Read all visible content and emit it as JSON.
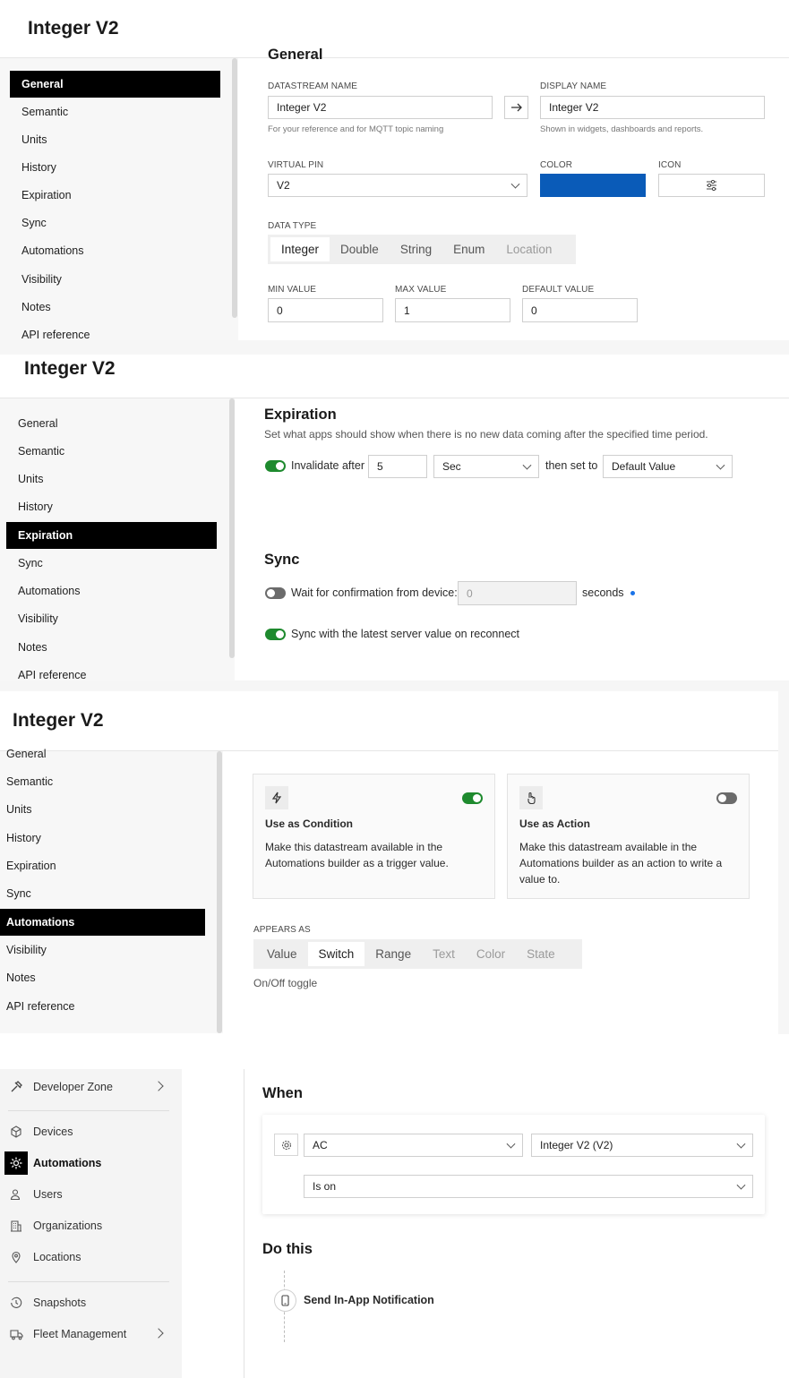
{
  "title": "Integer V2",
  "nav_items": [
    "General",
    "Semantic",
    "Units",
    "History",
    "Expiration",
    "Sync",
    "Automations",
    "Visibility",
    "Notes",
    "API reference"
  ],
  "general": {
    "heading": "General",
    "datastream_name_label": "DATASTREAM NAME",
    "datastream_name_value": "Integer V2",
    "datastream_name_help": "For your reference and for MQTT topic naming",
    "display_name_label": "DISPLAY NAME",
    "display_name_value": "Integer V2",
    "display_name_help": "Shown in widgets, dashboards and reports.",
    "virtual_pin_label": "VIRTUAL PIN",
    "virtual_pin_value": "V2",
    "color_label": "COLOR",
    "color_value": "#0a5bb8",
    "icon_label": "ICON",
    "icon_name": "sliders-icon",
    "data_type_label": "DATA TYPE",
    "data_types": [
      "Integer",
      "Double",
      "String",
      "Enum",
      "Location"
    ],
    "data_type_selected": "Integer",
    "min_label": "MIN VALUE",
    "min_value": "0",
    "max_label": "MAX VALUE",
    "max_value": "1",
    "default_label": "DEFAULT VALUE",
    "default_value": "0"
  },
  "expiration": {
    "heading": "Expiration",
    "description": "Set what apps should show when there is no new data coming after the specified time period.",
    "invalidate_label": "Invalidate after",
    "invalidate_on": true,
    "invalidate_value": "5",
    "unit": "Sec",
    "then_label": "then set to",
    "then_value": "Default Value"
  },
  "sync": {
    "heading": "Sync",
    "wait_label": "Wait for confirmation from device:",
    "wait_on": false,
    "wait_placeholder": "0",
    "seconds_label": "seconds",
    "sync_label": "Sync with the latest server value on reconnect",
    "sync_on": true
  },
  "automations": {
    "condition_title": "Use as Condition",
    "condition_desc": "Make this datastream available in the Automations builder as a trigger value.",
    "condition_on": true,
    "action_title": "Use as Action",
    "action_desc": "Make this datastream available in the Automations builder as an action to write a value to.",
    "action_on": false,
    "appears_label": "APPEARS AS",
    "appears_options": [
      "Value",
      "Switch",
      "Range",
      "Text",
      "Color",
      "State"
    ],
    "appears_selected": "Switch",
    "appears_help": "On/Off toggle"
  },
  "app_nav": {
    "developer_zone": "Developer Zone",
    "items": [
      "Devices",
      "Automations",
      "Users",
      "Organizations",
      "Locations"
    ],
    "active": "Automations",
    "snapshots": "Snapshots",
    "fleet": "Fleet Management"
  },
  "builder": {
    "when_heading": "When",
    "device_value": "AC",
    "datastream_value": "Integer V2 (V2)",
    "condition_value": "Is on",
    "do_heading": "Do this",
    "action_label": "Send In-App Notification"
  }
}
